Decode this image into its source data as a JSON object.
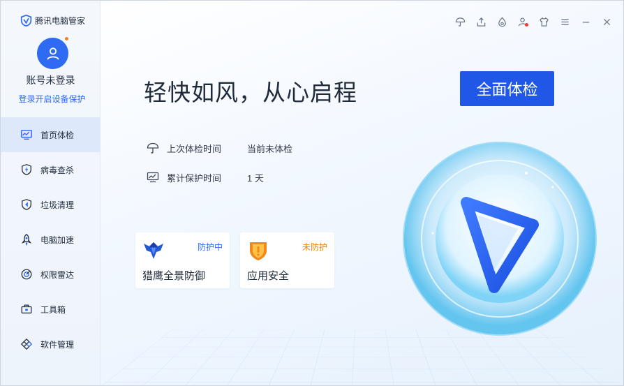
{
  "app": {
    "title": "腾讯电脑管家"
  },
  "account": {
    "name": "账号未登录",
    "login_link": "登录开启设备保护"
  },
  "sidebar": {
    "items": [
      {
        "label": "首页体检",
        "icon": "monitor-chart-icon",
        "active": true
      },
      {
        "label": "病毒查杀",
        "icon": "shield-bolt-icon",
        "active": false
      },
      {
        "label": "垃圾清理",
        "icon": "broom-shield-icon",
        "active": false
      },
      {
        "label": "电脑加速",
        "icon": "rocket-icon",
        "active": false
      },
      {
        "label": "权限雷达",
        "icon": "radar-icon",
        "active": false
      },
      {
        "label": "工具箱",
        "icon": "toolbox-icon",
        "active": false
      },
      {
        "label": "软件管理",
        "icon": "apps-icon",
        "active": false
      }
    ]
  },
  "topbar": {
    "icons": [
      "umbrella-icon",
      "upload-icon",
      "flame-icon",
      "user-badge-icon",
      "shirt-icon",
      "menu-icon",
      "minimize-icon",
      "close-icon"
    ]
  },
  "main": {
    "headline": "轻快如风，从心启程",
    "scan_button": "全面体检",
    "last_scan_label": "上次体检时间",
    "last_scan_value": "当前未体检",
    "protect_label": "累计保护时间",
    "protect_value": "1 天"
  },
  "cards": [
    {
      "title": "猎鹰全景防御",
      "status": "防护中",
      "status_color": "#2f6bf2",
      "icon": "eagle-icon"
    },
    {
      "title": "应用安全",
      "status": "未防护",
      "status_color": "#e88a00",
      "icon": "shield-warning-icon"
    }
  ],
  "colors": {
    "accent": "#2057e6",
    "link": "#2f6bf2",
    "warning": "#e88a00"
  }
}
